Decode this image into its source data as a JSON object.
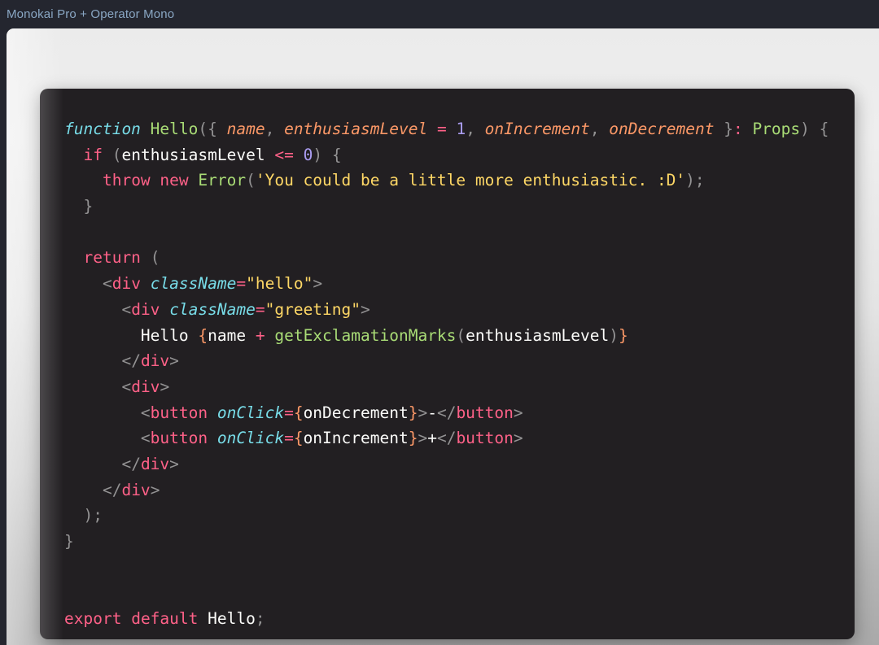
{
  "header": {
    "title": "Monokai Pro + Operator Mono",
    "title_color": "#8aa7c4",
    "bg_color": "#24262f"
  },
  "theme": {
    "name": "Monokai Pro",
    "font_name": "Operator Mono",
    "panel_bg": "#221f22",
    "frame_bg_top": "#ebebeb",
    "frame_bg_bottom": "#a9a9a9",
    "colors": {
      "keyword": "#ff6188",
      "keyword_italic": "#78dce8",
      "function": "#a9dc76",
      "parameter": "#fc9867",
      "number": "#ab9df2",
      "string": "#ffd866",
      "punctuation": "#939293",
      "text": "#fcfcfa",
      "brace": "#fc9867"
    }
  },
  "code": {
    "language": "tsx",
    "lines": [
      {
        "n": 1,
        "text": "function Hello({ name, enthusiasmLevel = 1, onIncrement, onDecrement }: Props) {",
        "tokens": [
          {
            "t": "function",
            "c": "t-kw-it"
          },
          {
            "t": " ",
            "c": "t-text"
          },
          {
            "t": "Hello",
            "c": "t-fn"
          },
          {
            "t": "(",
            "c": "t-punc"
          },
          {
            "t": "{",
            "c": "t-punc"
          },
          {
            "t": " ",
            "c": "t-text"
          },
          {
            "t": "name",
            "c": "t-param"
          },
          {
            "t": ", ",
            "c": "t-punc"
          },
          {
            "t": "enthusiasmLevel",
            "c": "t-param"
          },
          {
            "t": " ",
            "c": "t-text"
          },
          {
            "t": "=",
            "c": "t-op"
          },
          {
            "t": " ",
            "c": "t-text"
          },
          {
            "t": "1",
            "c": "t-num"
          },
          {
            "t": ", ",
            "c": "t-punc"
          },
          {
            "t": "onIncrement",
            "c": "t-param"
          },
          {
            "t": ", ",
            "c": "t-punc"
          },
          {
            "t": "onDecrement",
            "c": "t-param"
          },
          {
            "t": " ",
            "c": "t-text"
          },
          {
            "t": "}",
            "c": "t-punc"
          },
          {
            "t": ":",
            "c": "t-op"
          },
          {
            "t": " ",
            "c": "t-text"
          },
          {
            "t": "Props",
            "c": "t-fn"
          },
          {
            "t": ")",
            "c": "t-punc"
          },
          {
            "t": " ",
            "c": "t-text"
          },
          {
            "t": "{",
            "c": "t-punc"
          }
        ]
      },
      {
        "n": 2,
        "text": "  if (enthusiasmLevel <= 0) {",
        "tokens": [
          {
            "t": "  ",
            "c": "t-text"
          },
          {
            "t": "if",
            "c": "t-kw"
          },
          {
            "t": " ",
            "c": "t-text"
          },
          {
            "t": "(",
            "c": "t-punc"
          },
          {
            "t": "enthusiasmLevel",
            "c": "t-text"
          },
          {
            "t": " ",
            "c": "t-text"
          },
          {
            "t": "<=",
            "c": "t-op"
          },
          {
            "t": " ",
            "c": "t-text"
          },
          {
            "t": "0",
            "c": "t-num"
          },
          {
            "t": ")",
            "c": "t-punc"
          },
          {
            "t": " ",
            "c": "t-text"
          },
          {
            "t": "{",
            "c": "t-punc"
          }
        ]
      },
      {
        "n": 3,
        "text": "    throw new Error('You could be a little more enthusiastic. :D');",
        "tokens": [
          {
            "t": "    ",
            "c": "t-text"
          },
          {
            "t": "throw",
            "c": "t-kw"
          },
          {
            "t": " ",
            "c": "t-text"
          },
          {
            "t": "new",
            "c": "t-kw"
          },
          {
            "t": " ",
            "c": "t-text"
          },
          {
            "t": "Error",
            "c": "t-fn"
          },
          {
            "t": "(",
            "c": "t-punc"
          },
          {
            "t": "'You could be a little more enthusiastic. :D'",
            "c": "t-str"
          },
          {
            "t": ")",
            "c": "t-punc"
          },
          {
            "t": ";",
            "c": "t-punc"
          }
        ]
      },
      {
        "n": 4,
        "text": "  }",
        "tokens": [
          {
            "t": "  ",
            "c": "t-text"
          },
          {
            "t": "}",
            "c": "t-punc"
          }
        ]
      },
      {
        "n": 5,
        "text": "",
        "tokens": []
      },
      {
        "n": 6,
        "text": "  return (",
        "tokens": [
          {
            "t": "  ",
            "c": "t-text"
          },
          {
            "t": "return",
            "c": "t-kw"
          },
          {
            "t": " ",
            "c": "t-text"
          },
          {
            "t": "(",
            "c": "t-punc"
          }
        ]
      },
      {
        "n": 7,
        "text": "    <div className=\"hello\">",
        "tokens": [
          {
            "t": "    ",
            "c": "t-text"
          },
          {
            "t": "<",
            "c": "t-punc"
          },
          {
            "t": "div",
            "c": "t-tag"
          },
          {
            "t": " ",
            "c": "t-text"
          },
          {
            "t": "className",
            "c": "t-kw-it"
          },
          {
            "t": "=",
            "c": "t-op"
          },
          {
            "t": "\"hello\"",
            "c": "t-str"
          },
          {
            "t": ">",
            "c": "t-punc"
          }
        ]
      },
      {
        "n": 8,
        "text": "      <div className=\"greeting\">",
        "tokens": [
          {
            "t": "      ",
            "c": "t-text"
          },
          {
            "t": "<",
            "c": "t-punc"
          },
          {
            "t": "div",
            "c": "t-tag"
          },
          {
            "t": " ",
            "c": "t-text"
          },
          {
            "t": "className",
            "c": "t-kw-it"
          },
          {
            "t": "=",
            "c": "t-op"
          },
          {
            "t": "\"greeting\"",
            "c": "t-str"
          },
          {
            "t": ">",
            "c": "t-punc"
          }
        ]
      },
      {
        "n": 9,
        "text": "        Hello {name + getExclamationMarks(enthusiasmLevel)}",
        "tokens": [
          {
            "t": "        ",
            "c": "t-text"
          },
          {
            "t": "Hello ",
            "c": "t-text"
          },
          {
            "t": "{",
            "c": "t-brace"
          },
          {
            "t": "name",
            "c": "t-text"
          },
          {
            "t": " ",
            "c": "t-text"
          },
          {
            "t": "+",
            "c": "t-op"
          },
          {
            "t": " ",
            "c": "t-text"
          },
          {
            "t": "getExclamationMarks",
            "c": "t-fn"
          },
          {
            "t": "(",
            "c": "t-punc"
          },
          {
            "t": "enthusiasmLevel",
            "c": "t-text"
          },
          {
            "t": ")",
            "c": "t-punc"
          },
          {
            "t": "}",
            "c": "t-brace"
          }
        ]
      },
      {
        "n": 10,
        "text": "      </div>",
        "tokens": [
          {
            "t": "      ",
            "c": "t-text"
          },
          {
            "t": "</",
            "c": "t-punc"
          },
          {
            "t": "div",
            "c": "t-tag"
          },
          {
            "t": ">",
            "c": "t-punc"
          }
        ]
      },
      {
        "n": 11,
        "text": "      <div>",
        "tokens": [
          {
            "t": "      ",
            "c": "t-text"
          },
          {
            "t": "<",
            "c": "t-punc"
          },
          {
            "t": "div",
            "c": "t-tag"
          },
          {
            "t": ">",
            "c": "t-punc"
          }
        ]
      },
      {
        "n": 12,
        "text": "        <button onClick={onDecrement}>-</button>",
        "tokens": [
          {
            "t": "        ",
            "c": "t-text"
          },
          {
            "t": "<",
            "c": "t-punc"
          },
          {
            "t": "button",
            "c": "t-tag"
          },
          {
            "t": " ",
            "c": "t-text"
          },
          {
            "t": "onClick",
            "c": "t-kw-it"
          },
          {
            "t": "=",
            "c": "t-op"
          },
          {
            "t": "{",
            "c": "t-brace"
          },
          {
            "t": "onDecrement",
            "c": "t-text"
          },
          {
            "t": "}",
            "c": "t-brace"
          },
          {
            "t": ">",
            "c": "t-punc"
          },
          {
            "t": "-",
            "c": "t-text"
          },
          {
            "t": "</",
            "c": "t-punc"
          },
          {
            "t": "button",
            "c": "t-tag"
          },
          {
            "t": ">",
            "c": "t-punc"
          }
        ]
      },
      {
        "n": 13,
        "text": "        <button onClick={onIncrement}>+</button>",
        "tokens": [
          {
            "t": "        ",
            "c": "t-text"
          },
          {
            "t": "<",
            "c": "t-punc"
          },
          {
            "t": "button",
            "c": "t-tag"
          },
          {
            "t": " ",
            "c": "t-text"
          },
          {
            "t": "onClick",
            "c": "t-kw-it"
          },
          {
            "t": "=",
            "c": "t-op"
          },
          {
            "t": "{",
            "c": "t-brace"
          },
          {
            "t": "onIncrement",
            "c": "t-text"
          },
          {
            "t": "}",
            "c": "t-brace"
          },
          {
            "t": ">",
            "c": "t-punc"
          },
          {
            "t": "+",
            "c": "t-text"
          },
          {
            "t": "</",
            "c": "t-punc"
          },
          {
            "t": "button",
            "c": "t-tag"
          },
          {
            "t": ">",
            "c": "t-punc"
          }
        ]
      },
      {
        "n": 14,
        "text": "      </div>",
        "tokens": [
          {
            "t": "      ",
            "c": "t-text"
          },
          {
            "t": "</",
            "c": "t-punc"
          },
          {
            "t": "div",
            "c": "t-tag"
          },
          {
            "t": ">",
            "c": "t-punc"
          }
        ]
      },
      {
        "n": 15,
        "text": "    </div>",
        "tokens": [
          {
            "t": "    ",
            "c": "t-text"
          },
          {
            "t": "</",
            "c": "t-punc"
          },
          {
            "t": "div",
            "c": "t-tag"
          },
          {
            "t": ">",
            "c": "t-punc"
          }
        ]
      },
      {
        "n": 16,
        "text": "  );",
        "tokens": [
          {
            "t": "  ",
            "c": "t-text"
          },
          {
            "t": ")",
            "c": "t-punc"
          },
          {
            "t": ";",
            "c": "t-punc"
          }
        ]
      },
      {
        "n": 17,
        "text": "}",
        "tokens": [
          {
            "t": "}",
            "c": "t-punc"
          }
        ]
      },
      {
        "n": 18,
        "text": "",
        "tokens": []
      },
      {
        "n": 19,
        "text": "",
        "tokens": []
      },
      {
        "n": 20,
        "text": "export default Hello;",
        "tokens": [
          {
            "t": "export",
            "c": "t-kw"
          },
          {
            "t": " ",
            "c": "t-text"
          },
          {
            "t": "default",
            "c": "t-kw"
          },
          {
            "t": " ",
            "c": "t-text"
          },
          {
            "t": "Hello",
            "c": "t-text"
          },
          {
            "t": ";",
            "c": "t-punc"
          }
        ]
      }
    ]
  }
}
